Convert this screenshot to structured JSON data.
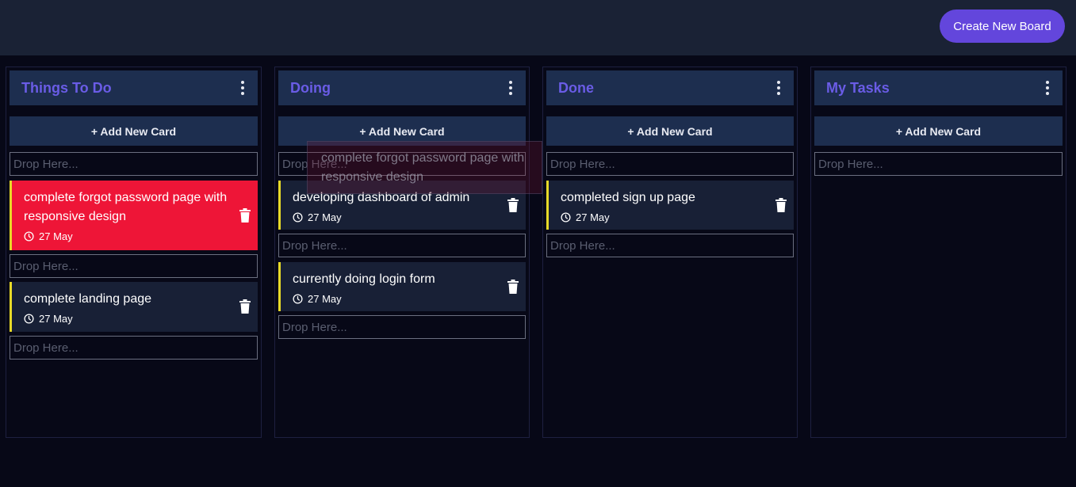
{
  "header": {
    "create_board_label": "Create New Board"
  },
  "columns": [
    {
      "title": "Things To Do",
      "add_label": "+ Add New Card",
      "drop_label": "Drop Here...",
      "cards": [
        {
          "text": "complete forgot password page with responsive design",
          "date": "27 May",
          "highlight": true
        },
        {
          "text": "complete landing page",
          "date": "27 May",
          "highlight": false
        }
      ]
    },
    {
      "title": "Doing",
      "add_label": "+ Add New Card",
      "drop_label": "Drop Here...",
      "cards": [
        {
          "text": "developing dashboard of admin",
          "date": "27 May",
          "highlight": false
        },
        {
          "text": "currently doing login form",
          "date": "27 May",
          "highlight": false
        }
      ]
    },
    {
      "title": "Done",
      "add_label": "+ Add New Card",
      "drop_label": "Drop Here...",
      "cards": [
        {
          "text": "completed sign up page",
          "date": "27 May",
          "highlight": false
        }
      ]
    },
    {
      "title": "My Tasks",
      "add_label": "+ Add New Card",
      "drop_label": "Drop Here...",
      "cards": []
    }
  ],
  "drag_ghost": {
    "text": "complete forgot password page with responsive design"
  },
  "colors": {
    "accent": "#6346dc",
    "column_title": "#6a5ce6",
    "card_highlight": "#ee1537",
    "card_border": "#e7d928"
  },
  "icons": [
    "kebab-menu-icon",
    "clock-icon",
    "trash-icon"
  ]
}
